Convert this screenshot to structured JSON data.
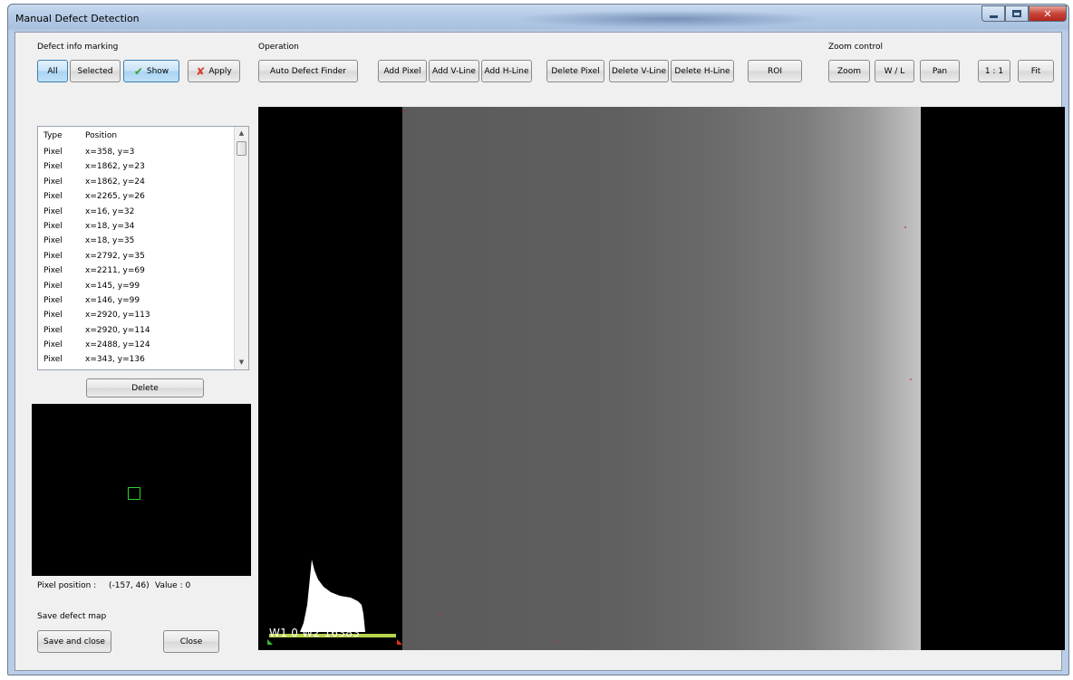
{
  "window": {
    "title": "Manual Defect Detection"
  },
  "defect_info": {
    "group_label": "Defect info marking",
    "buttons": {
      "all": "All",
      "selected": "Selected",
      "show": "Show",
      "apply": "Apply"
    },
    "columns": {
      "type": "Type",
      "position": "Position"
    },
    "rows": [
      {
        "type": "Pixel",
        "position": "x=358, y=3"
      },
      {
        "type": "Pixel",
        "position": "x=1862, y=23"
      },
      {
        "type": "Pixel",
        "position": "x=1862, y=24"
      },
      {
        "type": "Pixel",
        "position": "x=2265, y=26"
      },
      {
        "type": "Pixel",
        "position": "x=16, y=32"
      },
      {
        "type": "Pixel",
        "position": "x=18, y=34"
      },
      {
        "type": "Pixel",
        "position": "x=18, y=35"
      },
      {
        "type": "Pixel",
        "position": "x=2792, y=35"
      },
      {
        "type": "Pixel",
        "position": "x=2211, y=69"
      },
      {
        "type": "Pixel",
        "position": "x=145, y=99"
      },
      {
        "type": "Pixel",
        "position": "x=146, y=99"
      },
      {
        "type": "Pixel",
        "position": "x=2920, y=113"
      },
      {
        "type": "Pixel",
        "position": "x=2920, y=114"
      },
      {
        "type": "Pixel",
        "position": "x=2488, y=124"
      },
      {
        "type": "Pixel",
        "position": "x=343, y=136"
      }
    ],
    "delete_label": "Delete"
  },
  "operation": {
    "group_label": "Operation",
    "auto": "Auto Defect Finder",
    "add_pixel": "Add Pixel",
    "add_vline": "Add V-Line",
    "add_hline": "Add H-Line",
    "delete_pixel": "Delete Pixel",
    "delete_vline": "Delete V-Line",
    "delete_hline": "Delete H-Line",
    "roi": "ROI"
  },
  "zoom_control": {
    "group_label": "Zoom control",
    "zoom": "Zoom",
    "wl": "W / L",
    "pan": "Pan",
    "one_to_one": "1 : 1",
    "fit": "Fit"
  },
  "status": {
    "pixel_position_label": "Pixel position :",
    "pixel_position_value": "(-157, 46)",
    "value_label": "Value : 0"
  },
  "save": {
    "group_label": "Save defect map",
    "save_and_close": "Save and close",
    "close": "Close"
  },
  "viewer": {
    "window_level": "W1 0  W2 16383"
  },
  "colors": {
    "accent_select": "#c7e3f8",
    "check_green": "#3aa23a",
    "apply_red": "#d83a2a",
    "roi_green": "#2fd02f",
    "histogram_bar": "#b8d44a"
  }
}
